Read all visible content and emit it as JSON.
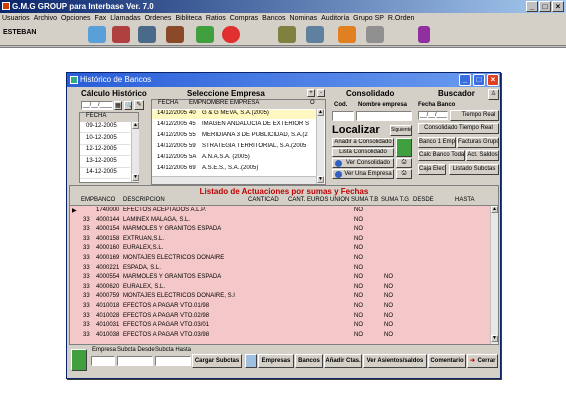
{
  "app": {
    "title": "G.M.G GROUP para Interbase Ver. 7.0",
    "user": "ESTEBAN",
    "menu": [
      "Usuarios",
      "Archivo",
      "Opciones",
      "Fax",
      "Llamadas",
      "Ordenes",
      "Bibliteca",
      "Ratios",
      "Compras",
      "Bancos",
      "Nominas",
      "Auditoría",
      "Grupo SP",
      "R.Orden"
    ]
  },
  "window": {
    "title": "Histórico de Bancos",
    "calc": {
      "title": "Cálculo Histórico",
      "date_placeholder": "__/__/____",
      "col_fecha": "FECHA",
      "dates": [
        "09-12-2005",
        "10-12-2005",
        "12-12-2005",
        "13-12-2005",
        "14-12-2005"
      ]
    },
    "empresa": {
      "title": "Seleccione Empresa",
      "columns": [
        "FECHA",
        "EMP",
        "NOMBRE EMPRESA",
        "O"
      ],
      "rows": [
        {
          "fecha": "14/12/2005",
          "emp": "40",
          "nombre": "G & G MEVA, S.A.(2005)"
        },
        {
          "fecha": "14/12/2005",
          "emp": "45",
          "nombre": "IMAGEN ANDALUCIA DE EXTERIOR S"
        },
        {
          "fecha": "14/12/2005",
          "emp": "55",
          "nombre": "MERIDIANA 3 DE PUBLICIDAD, S.A.(2"
        },
        {
          "fecha": "14/12/2005",
          "emp": "59",
          "nombre": "STRATEGIA TERRITORIAL, S.A.(2005"
        },
        {
          "fecha": "14/12/2005",
          "emp": "5A",
          "nombre": "A.N.A.S.A. (2005)"
        },
        {
          "fecha": "14/12/2005",
          "emp": "69",
          "nombre": "A.S.E.S., S.A..(2005)"
        }
      ]
    },
    "consolidado": {
      "title": "Consolidado",
      "col_cod": "Cod.",
      "col_nombre": "Nombre empresa",
      "localizar": "Localizar",
      "siguiente": "Siguiente",
      "btn_anadir": "Añadir a Consolidado",
      "btn_lista": "Lista Consolidado",
      "btn_ver_consolidado": "Ver Consolidado",
      "btn_ver_empresa": "Ver Una Empresa"
    },
    "buscador": {
      "title": "Buscador",
      "fecha_banco": "Fecha Banco",
      "date_placeholder": "__/__/____",
      "btn_tiempo_real": "Tiempo Real",
      "btn_consolidado_tr": "Consolidado Tiempo Real",
      "btn_banco_emp": "Banco 1 Emp.",
      "btn_facturas_grupo": "Facturas Grupo",
      "btn_calc_banco": "Calc Banco Todas",
      "btn_act_saldos": "Act. Saldos",
      "btn_caja_elect": "Caja Elect.",
      "btn_listado_subcta": "Listado Subctas"
    },
    "grid": {
      "title": "Listado de Actuaciones por sumas y Fechas",
      "columns": [
        "EMP",
        "BANCO",
        "DESCRIPCION",
        "CANTICAD",
        "CANT. EUROS",
        "UNION",
        "SUMA T.B",
        "SUMA T.G",
        "DESDE",
        "HASTA"
      ],
      "rows": [
        {
          "emp": "",
          "banco": "1740000",
          "desc": "EFECTOS ACEPTADOS A.L.P.",
          "suma_tb": "NO",
          "suma_tg": ""
        },
        {
          "emp": "33",
          "banco": "4000144",
          "desc": "LAMINEX MALAGA, S.L.",
          "suma_tb": "NO",
          "suma_tg": ""
        },
        {
          "emp": "33",
          "banco": "4000154",
          "desc": "MARMOLES Y GRANITOS ESPADA",
          "suma_tb": "NO",
          "suma_tg": ""
        },
        {
          "emp": "33",
          "banco": "4000158",
          "desc": "EXTRUAN,S.L.",
          "suma_tb": "NO",
          "suma_tg": ""
        },
        {
          "emp": "33",
          "banco": "4000160",
          "desc": "EURALEX,S.L.",
          "suma_tb": "NO",
          "suma_tg": ""
        },
        {
          "emp": "33",
          "banco": "4000169",
          "desc": "MONTAJES ELECTRICOS DONAIRE",
          "suma_tb": "NO",
          "suma_tg": ""
        },
        {
          "emp": "33",
          "banco": "4000221",
          "desc": "ESPADA, S.L.",
          "suma_tb": "NO",
          "suma_tg": ""
        },
        {
          "emp": "33",
          "banco": "4000554",
          "desc": "MARMOLES Y GRANITOS ESPADA",
          "suma_tb": "NO",
          "suma_tg": "NO"
        },
        {
          "emp": "33",
          "banco": "4000620",
          "desc": "EURALEX, S.L.",
          "suma_tb": "NO",
          "suma_tg": "NO"
        },
        {
          "emp": "33",
          "banco": "4000759",
          "desc": "MONTAJES ELECTRICOS DONAIRE, S.I",
          "suma_tb": "NO",
          "suma_tg": "NO"
        },
        {
          "emp": "33",
          "banco": "4010018",
          "desc": "EFECTOS A PAGAR VTO.01/98",
          "suma_tb": "NO",
          "suma_tg": "NO"
        },
        {
          "emp": "33",
          "banco": "4010028",
          "desc": "EFECTOS A PAGAR VTO.02/98",
          "suma_tb": "NO",
          "suma_tg": "NO"
        },
        {
          "emp": "33",
          "banco": "4010031",
          "desc": "EFECTOS A PAGAR VTO.03/01",
          "suma_tb": "NO",
          "suma_tg": "NO"
        },
        {
          "emp": "33",
          "banco": "4010038",
          "desc": "EFECTOS A PAGAR VTO.03/98",
          "suma_tb": "NO",
          "suma_tg": "NO"
        }
      ]
    },
    "bottom": {
      "lbl_empresa": "Empresa",
      "lbl_subcta_desde": "Subcta Desde",
      "lbl_subcta_hasta": "Subcta Hasta",
      "btn_cargar": "Cargar Subctas",
      "tabs": [
        "Empresas",
        "Bancos",
        "Añadir Ctas.",
        "Ver Asientos/saldos",
        "Comentario"
      ],
      "btn_cerrar": "Cerrar"
    }
  }
}
